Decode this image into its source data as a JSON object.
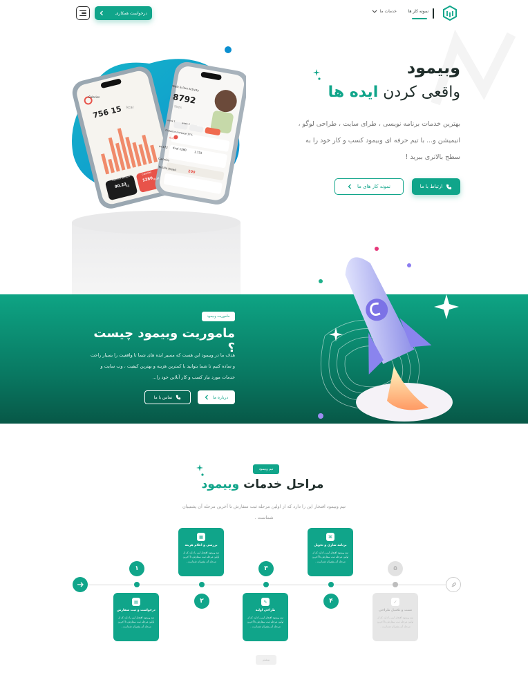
{
  "header": {
    "nav_portfolio": "نمونه کار ها",
    "nav_services": "خدمات ما",
    "cta_label": "درخواست همکاری"
  },
  "hero": {
    "title_line1": "وبیمود",
    "title_line2_prefix": "واقعی کردن",
    "title_line2_highlight": "ایده ها",
    "description": "بهترین خدمات برنامه نویسی ، طرای سایت ، طراحی لوگو ، انیمیشن و... با تیم حرفه ای وبیمود کسب و کار خود را به سطح بالاتری ببرید !",
    "btn_contact": "ارتباط با ما",
    "btn_portfolio": "نمونه کار های ما"
  },
  "phone_left": {
    "label": "Calories",
    "value": "15 756",
    "unit": "kcal",
    "stat1_label": "Current Weight",
    "stat1_value": "90.22",
    "stat1_unit": "Kg",
    "stat2_label": "Calories",
    "stat2_value": "1280",
    "stat2_unit": "Kcal"
  },
  "phone_right": {
    "title": "Walk & Run Activity",
    "value": "8792",
    "unit": "Steps",
    "tab1": "1 week",
    "tab2": "2 week",
    "tab3": "1 month",
    "row1": "Distance increase 37%",
    "row1_value": "6.06",
    "m1": "572 m",
    "m2": "1280 Kcal",
    "m3": "1.731",
    "row2": "Calories",
    "row3": "Tortilla bread",
    "row3_value": "200"
  },
  "mission": {
    "tag": "ماموریت وبیمود",
    "title": "ماموریت وبیمود چیست ؟",
    "description": "هدف ما در وبیمود این هست که مسیر ایده های شما تا واقعیت را بسیار راحت و ساده کنیم تا شما بتوانید با کمترین هزینه و بهترین کیفیت ، وب سایت و خدمات مورد نیاز کسب و کار آنلاین خود را...",
    "btn_about": "درباره ما",
    "btn_call": "تماس با ما"
  },
  "steps": {
    "tag": "تیم وبیمود",
    "title_prefix": "مراحل خدمات",
    "title_highlight": "وبیمود",
    "description": "تیم وبیمود افتخار این را دارد که از اولین مرحله ثبت سفارش تا آخرین مرحله آن پشتیبان شماست .",
    "nums": [
      "۱",
      "۲",
      "۳",
      "۴",
      "۵"
    ],
    "cards": [
      {
        "title": "درخواست و ثبت سفارش",
        "text": "تیم وبیمود افتخار این را دارد که از اولین مرحله ثبت سفارش تا آخرین مرحله آن پشتیبان شماست ."
      },
      {
        "title": "بررسی و اعلام هزینه",
        "text": "تیم وبیمود افتخار این را دارد که از اولین مرحله ثبت سفارش تا آخرین مرحله آن پشتیبان شماست ."
      },
      {
        "title": "طراحی اولیه",
        "text": "تیم وبیمود افتخار این را دارد که از اولین مرحله ثبت سفارش تا آخرین مرحله آن پشتیبان شماست ."
      },
      {
        "title": "برنامه سازی و تحویل",
        "text": "تیم وبیمود افتخار این را دارد که از اولین مرحله ثبت سفارش تا آخرین مرحله آن پشتیبان شماست ."
      },
      {
        "title": "تست و تکمیل طراحی",
        "text": "تیم وبیمود افتخار این را دارد که از اولین مرحله ثبت سفارش تا آخرین مرحله آن پشتیبان شماست ."
      }
    ],
    "more_label": "بیشتر"
  },
  "colors": {
    "brand": "#10a58a",
    "brand_dark": "#075847",
    "text": "#1f2d2a",
    "muted": "#777777"
  }
}
